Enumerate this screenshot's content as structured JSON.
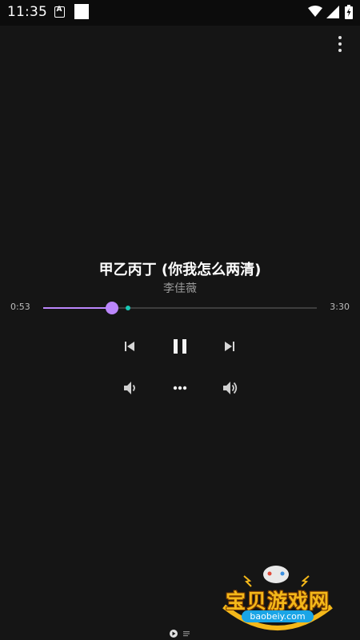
{
  "status_bar": {
    "time": "11:35",
    "notification_letter": "A",
    "icons": [
      "a-notification-icon",
      "square-notification-icon",
      "wifi-icon",
      "signal-icon",
      "battery-icon"
    ]
  },
  "header": {
    "menu_icon": "more-vert-icon"
  },
  "track": {
    "title": "甲乙丙丁 (你我怎么两清)",
    "artist": "李佳薇"
  },
  "progress": {
    "elapsed": "0:53",
    "total": "3:30",
    "played_fraction": 0.252,
    "buffered_fraction": 0.31
  },
  "controls": {
    "icons": [
      "skip-previous-icon",
      "pause-icon",
      "skip-next-icon",
      "volume-down-icon",
      "more-horiz-icon",
      "volume-up-icon"
    ]
  },
  "watermark": {
    "name": "宝贝游戏网",
    "url": "baobeiy.com"
  },
  "colors": {
    "background": "#151515",
    "status_bar": "#0c0c0c",
    "accent": "#bb86fc",
    "buffer_marker": "#18c7b6",
    "secondary_text": "#9a9a9a",
    "icon": "#d6d6d6"
  }
}
